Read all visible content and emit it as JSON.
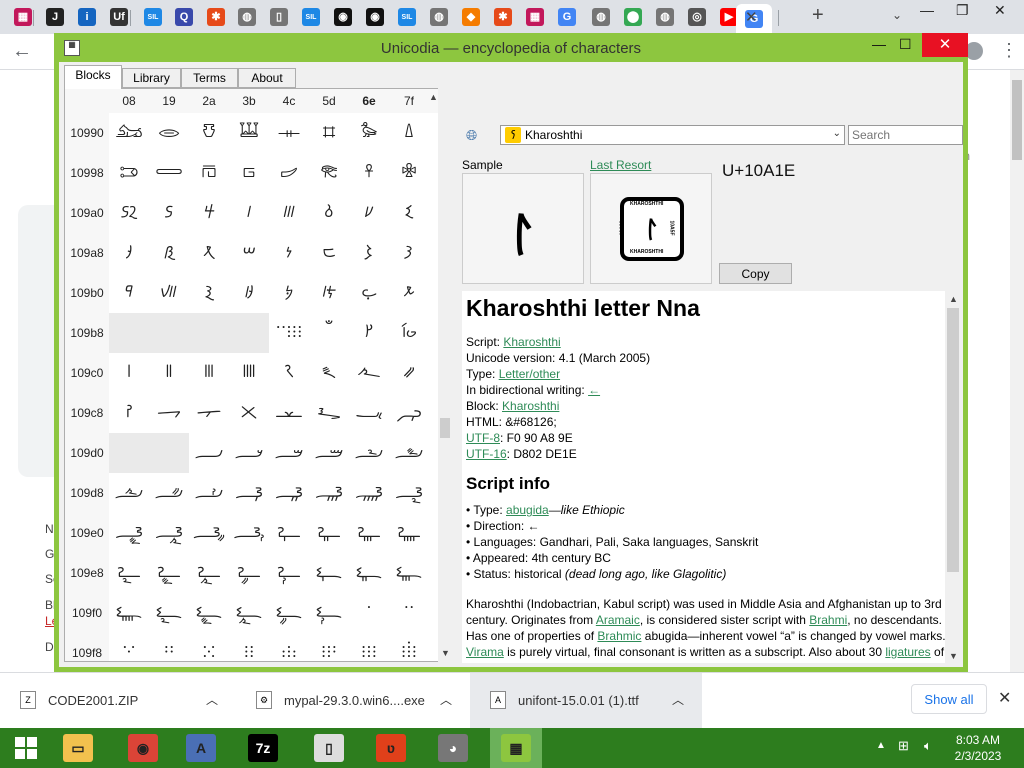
{
  "browser": {
    "tab_favicons": [
      {
        "name": "unicode-table-icon",
        "glyph": "▦",
        "color": "#c2185b"
      },
      {
        "name": "j-icon",
        "glyph": "J",
        "color": "#222222"
      },
      {
        "name": "info-icon",
        "glyph": "i",
        "color": "#1565c0"
      },
      {
        "name": "uf-icon",
        "glyph": "Uf",
        "color": "#333333"
      },
      {
        "name": "sil-icon",
        "glyph": "SIL",
        "color": "#1e88e5"
      },
      {
        "name": "q-icon",
        "glyph": "Q",
        "color": "#3949ab"
      },
      {
        "name": "puzzle-icon",
        "glyph": "✱",
        "color": "#e64a19"
      },
      {
        "name": "globe-icon",
        "glyph": "◍",
        "color": "#757575"
      },
      {
        "name": "page-icon",
        "glyph": "▯",
        "color": "#757575"
      },
      {
        "name": "sil-icon",
        "glyph": "SIL",
        "color": "#1e88e5"
      },
      {
        "name": "codepoints-icon",
        "glyph": "◉",
        "color": "#111111"
      },
      {
        "name": "codepoints-icon",
        "glyph": "◉",
        "color": "#111111"
      },
      {
        "name": "sil-icon",
        "glyph": "SIL",
        "color": "#1e88e5"
      },
      {
        "name": "globe-icon",
        "glyph": "◍",
        "color": "#757575"
      },
      {
        "name": "diamond-icon",
        "glyph": "◆",
        "color": "#f57c00"
      },
      {
        "name": "puzzle-icon",
        "glyph": "✱",
        "color": "#e64a19"
      },
      {
        "name": "unicode-table-icon",
        "glyph": "▦",
        "color": "#c2185b"
      },
      {
        "name": "google-icon",
        "glyph": "G",
        "color": "#4285f4"
      },
      {
        "name": "globe-icon",
        "glyph": "◍",
        "color": "#757575"
      },
      {
        "name": "maps-icon",
        "glyph": "⬤",
        "color": "#34a853"
      },
      {
        "name": "globe-icon",
        "glyph": "◍",
        "color": "#757575"
      },
      {
        "name": "chrome-icon",
        "glyph": "◎",
        "color": "#555555"
      },
      {
        "name": "youtube-icon",
        "glyph": "▶",
        "color": "#ff0000"
      },
      {
        "name": "google-icon",
        "glyph": "G",
        "color": "#4285f4"
      }
    ]
  },
  "window": {
    "title": "Unicodia — encyclopedia of characters",
    "tabs": [
      "Blocks",
      "Library",
      "Terms",
      "About"
    ]
  },
  "grid": {
    "columns": [
      "08",
      "19",
      "2a",
      "3b",
      "4c",
      "5d",
      "6e",
      "7f"
    ],
    "bold_column": 6,
    "rows": [
      {
        "label": "10990",
        "cells": [
          "𐦐",
          "𐦑",
          "𐦒",
          "𐦓",
          "𐦔",
          "𐦕",
          "𐦖",
          "𐦗"
        ]
      },
      {
        "label": "10998",
        "cells": [
          "𐦘",
          "𐦙",
          "𐦚",
          "𐦛",
          "𐦜",
          "𐦝",
          "𐦞",
          "𐦟"
        ]
      },
      {
        "label": "109a0",
        "cells": [
          "𐦠",
          "𐦡",
          "𐦢",
          "𐦣",
          "𐦤",
          "𐦥",
          "𐦦",
          "𐦧"
        ]
      },
      {
        "label": "109a8",
        "cells": [
          "𐦨",
          "𐦩",
          "𐦪",
          "𐦫",
          "𐦬",
          "𐦭",
          "𐦮",
          "𐦯"
        ]
      },
      {
        "label": "109b0",
        "cells": [
          "𐦰",
          "𐦱",
          "𐦲",
          "𐦳",
          "𐦴",
          "𐦵",
          "𐦶",
          "𐦷"
        ]
      },
      {
        "label": "109b8",
        "cells": [
          "",
          "",
          "",
          "",
          "𐦼",
          "𐦽",
          "𐦾",
          "𐦿"
        ]
      },
      {
        "label": "109c0",
        "cells": [
          "𐧀",
          "𐧁",
          "𐧂",
          "𐧃",
          "𐧄",
          "𐧅",
          "𐧆",
          "𐧇"
        ]
      },
      {
        "label": "109c8",
        "cells": [
          "𐧈",
          "𐧉",
          "𐧊",
          "𐧋",
          "𐧌",
          "𐧍",
          "𐧎",
          "𐧏"
        ]
      },
      {
        "label": "109d0",
        "cells": [
          "",
          "",
          "𐧒",
          "𐧓",
          "𐧔",
          "𐧕",
          "𐧖",
          "𐧗"
        ]
      },
      {
        "label": "109d8",
        "cells": [
          "𐧘",
          "𐧙",
          "𐧚",
          "𐧛",
          "𐧜",
          "𐧝",
          "𐧞",
          "𐧟"
        ]
      },
      {
        "label": "109e0",
        "cells": [
          "𐧠",
          "𐧡",
          "𐧢",
          "𐧣",
          "𐧤",
          "𐧥",
          "𐧦",
          "𐧧"
        ]
      },
      {
        "label": "109e8",
        "cells": [
          "𐧨",
          "𐧩",
          "𐧪",
          "𐧫",
          "𐧬",
          "𐧭",
          "𐧮",
          "𐧯"
        ]
      },
      {
        "label": "109f0",
        "cells": [
          "𐧰",
          "𐧱",
          "𐧲",
          "𐧳",
          "𐧴",
          "𐧵",
          "𐧶",
          "𐧷"
        ]
      },
      {
        "label": "109f8",
        "cells": [
          "𐧸",
          "𐧹",
          "𐧺",
          "𐧻",
          "𐧼",
          "𐧽",
          "𐧾",
          "𐧿"
        ]
      }
    ]
  },
  "panel": {
    "script_name": "Kharoshthi",
    "search_placeholder": "Search",
    "sample_label": "Sample",
    "lastresort_label": "Last Resort",
    "codepoint": "U+10A1E",
    "sample_glyph": "𐨞",
    "lastresort_glyph": "𐨞",
    "lastresort_side_text": "KHAROSHTHI",
    "lastresort_code_left": "10A00",
    "lastresort_code_right": "10A5F",
    "copy_label": "Copy"
  },
  "info": {
    "heading": "Kharoshthi letter Nna",
    "script_label": "Script: ",
    "script_value": "Kharoshthi",
    "version_line": "Unicode version: 4.1 (March 2005)",
    "type_label": "Type: ",
    "type_value": "Letter/other",
    "bidi_label": "In bidirectional writing: ",
    "bidi_value": "←",
    "block_label": "Block: ",
    "block_value": "Kharoshthi",
    "html_line": "HTML: &#68126;",
    "utf8_label": "UTF-8",
    "utf8_value": ": F0 90 A8 9E",
    "utf16_label": "UTF-16",
    "utf16_value": ": D802 DE1E",
    "script_info_heading": "Script info",
    "si_type_label": "• Type: ",
    "si_type_value": "abugida",
    "si_type_note": "—like Ethiopic",
    "si_direction": "• Direction: ←",
    "si_languages": "• Languages: Gandhari, Pali, Saka languages, Sanskrit",
    "si_appeared": "• Appeared: 4th century BC",
    "si_status_label": "• Status: historical ",
    "si_status_note": "(dead long ago, like Glagolitic)",
    "p1": "Kharoshthi (Indobactrian, Kabul script) was used in Middle Asia and Afghanistan up to 3rd century. Originates from ",
    "p1_link1": "Aramaic",
    "p1_b": ", is considered sister script with ",
    "p1_link2": "Brahmi",
    "p1_c": ", no descendants. Has one of properties of ",
    "p1_link3": "Brahmic",
    "p1_d": " abugida—inherent vowel “a” is changed by vowel marks. ",
    "p1_link4": "Virama",
    "p1_e": " is purely virtual, final consonant is written as a subscript. Also about 30 ",
    "p1_link5": "ligatures",
    "p1_f": " of double consonants are known:"
  },
  "background_page": {
    "letters": [
      "N",
      "G",
      "Sc",
      "Bl",
      "Le",
      "D"
    ],
    "fragment": "th"
  },
  "downloads": [
    {
      "name": "CODE2001.ZIP",
      "icon": "Z"
    },
    {
      "name": "mypal-29.3.0.win6....exe",
      "icon": "⚙"
    },
    {
      "name": "unifont-15.0.01 (1).ttf",
      "icon": "A"
    }
  ],
  "downloads_show_all": "Show all",
  "taskbar": {
    "apps": [
      {
        "name": "file-explorer-icon",
        "glyph": "▭",
        "color": "#f2c14e"
      },
      {
        "name": "chrome-icon",
        "glyph": "◉",
        "color": "#db4437"
      },
      {
        "name": "font-app-icon",
        "glyph": "A",
        "color": "#4a6fb5"
      },
      {
        "name": "7zip-icon",
        "glyph": "7z",
        "color": "#000000"
      },
      {
        "name": "document-icon",
        "glyph": "▯",
        "color": "#dddddd"
      },
      {
        "name": "fontforge-icon",
        "glyph": "ʋ",
        "color": "#e0401a"
      },
      {
        "name": "raccoon-icon",
        "glyph": "◕",
        "color": "#777777"
      },
      {
        "name": "unicodia-icon",
        "glyph": "▦",
        "color": "#8dc63f"
      }
    ],
    "time": "8:03 AM",
    "date": "2/3/2023"
  },
  "colors": {
    "window_frame": "#8dc63f",
    "link": "#2e8b57",
    "taskbar": "#2d7d1e",
    "close_button": "#e81123"
  }
}
